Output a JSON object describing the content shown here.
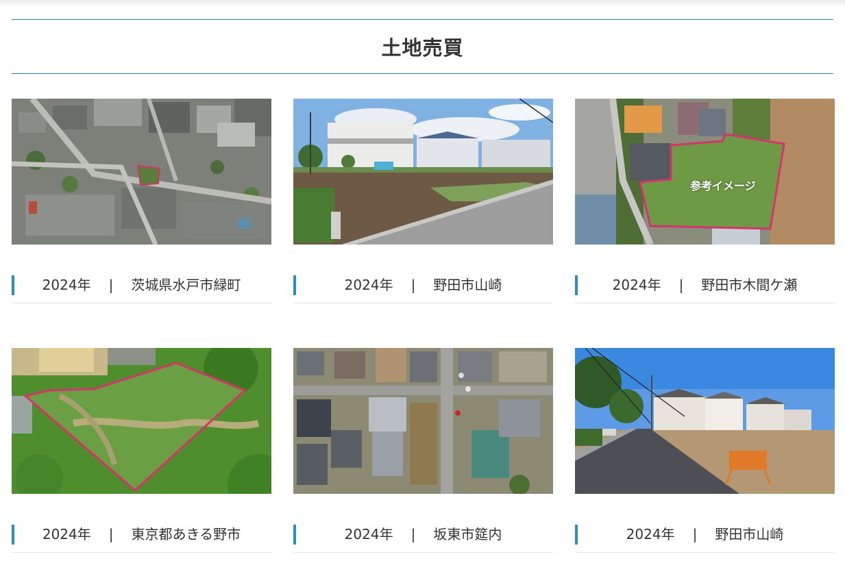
{
  "section": {
    "title": "土地売買"
  },
  "cards": [
    {
      "year": "2024年",
      "separator": "|",
      "location": "茨城県水戸市緑町",
      "image": "aerial-neighborhood"
    },
    {
      "year": "2024年",
      "separator": "|",
      "location": "野田市山崎",
      "image": "street-lot"
    },
    {
      "year": "2024年",
      "separator": "|",
      "location": "野田市木間ケ瀬",
      "image": "aerial-field",
      "overlay_text": "参考イメージ"
    },
    {
      "year": "2024年",
      "separator": "|",
      "location": "東京都あきる野市",
      "image": "aerial-overgrown"
    },
    {
      "year": "2024年",
      "separator": "|",
      "location": "坂東市筵内",
      "image": "aerial-houses"
    },
    {
      "year": "2024年",
      "separator": "|",
      "location": "野田市山崎",
      "image": "street-houses"
    }
  ]
}
